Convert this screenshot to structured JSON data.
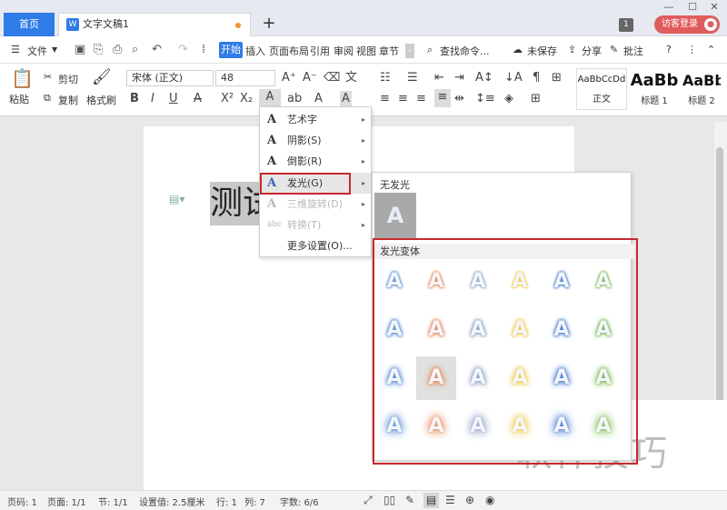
{
  "tabs": {
    "home": "首页",
    "document": "文字文稿1"
  },
  "titlebar": {
    "badge": "1",
    "login": "访客登录",
    "avatar_icon": "user-icon"
  },
  "menu": {
    "file": "文件",
    "items": [
      "开始",
      "插入",
      "页面布局",
      "引用",
      "审阅",
      "视图",
      "章节"
    ],
    "search": "查找命令...",
    "unsaved": "未保存",
    "share": "分享",
    "comment": "批注"
  },
  "toolbar": {
    "paste": "粘贴",
    "cut": "剪切",
    "copy": "复制",
    "format_painter": "格式刷",
    "font_name": "宋体 (正文)",
    "font_size": "48",
    "styles": [
      {
        "preview": "AaBbCcDd",
        "name": "正文"
      },
      {
        "preview": "AaBb",
        "name": "标题 1"
      },
      {
        "preview": "AaBb",
        "name": "标题 2"
      }
    ]
  },
  "document": {
    "text": "测试"
  },
  "dropdown": {
    "items": [
      {
        "icon": "A",
        "label": "艺术字",
        "arrow": true,
        "enabled": true
      },
      {
        "icon": "A",
        "label": "阴影(S)",
        "arrow": true,
        "enabled": true
      },
      {
        "icon": "A",
        "label": "倒影(R)",
        "arrow": true,
        "enabled": true
      },
      {
        "icon": "A",
        "label": "发光(G)",
        "arrow": true,
        "enabled": true
      },
      {
        "icon": "A",
        "label": "三维旋转(D)",
        "arrow": true,
        "enabled": false
      },
      {
        "icon": "abc",
        "label": "转换(T)",
        "arrow": true,
        "enabled": false
      },
      {
        "icon": "",
        "label": "更多设置(O)...",
        "arrow": false,
        "enabled": true
      }
    ]
  },
  "submenu": {
    "no_glow": "无发光",
    "swatch_letter": "A",
    "variants_title": "发光变体",
    "glow_colors": [
      "#5b8fd6",
      "#e8875a",
      "#8fa3c7",
      "#f0c94a",
      "#4a7fd1",
      "#7dbb5a"
    ]
  },
  "statusbar": {
    "page_num": "页码: 1",
    "pages": "页面: 1/1",
    "section": "节: 1/1",
    "setting": "设置值: 2.5厘米",
    "row": "行: 1",
    "col": "列: 7",
    "chars": "字数: 6/6"
  },
  "watermark": "软件技巧",
  "colors": {
    "accent": "#2f7be8",
    "highlight": "#c8282d",
    "login": "#e05c5c"
  }
}
